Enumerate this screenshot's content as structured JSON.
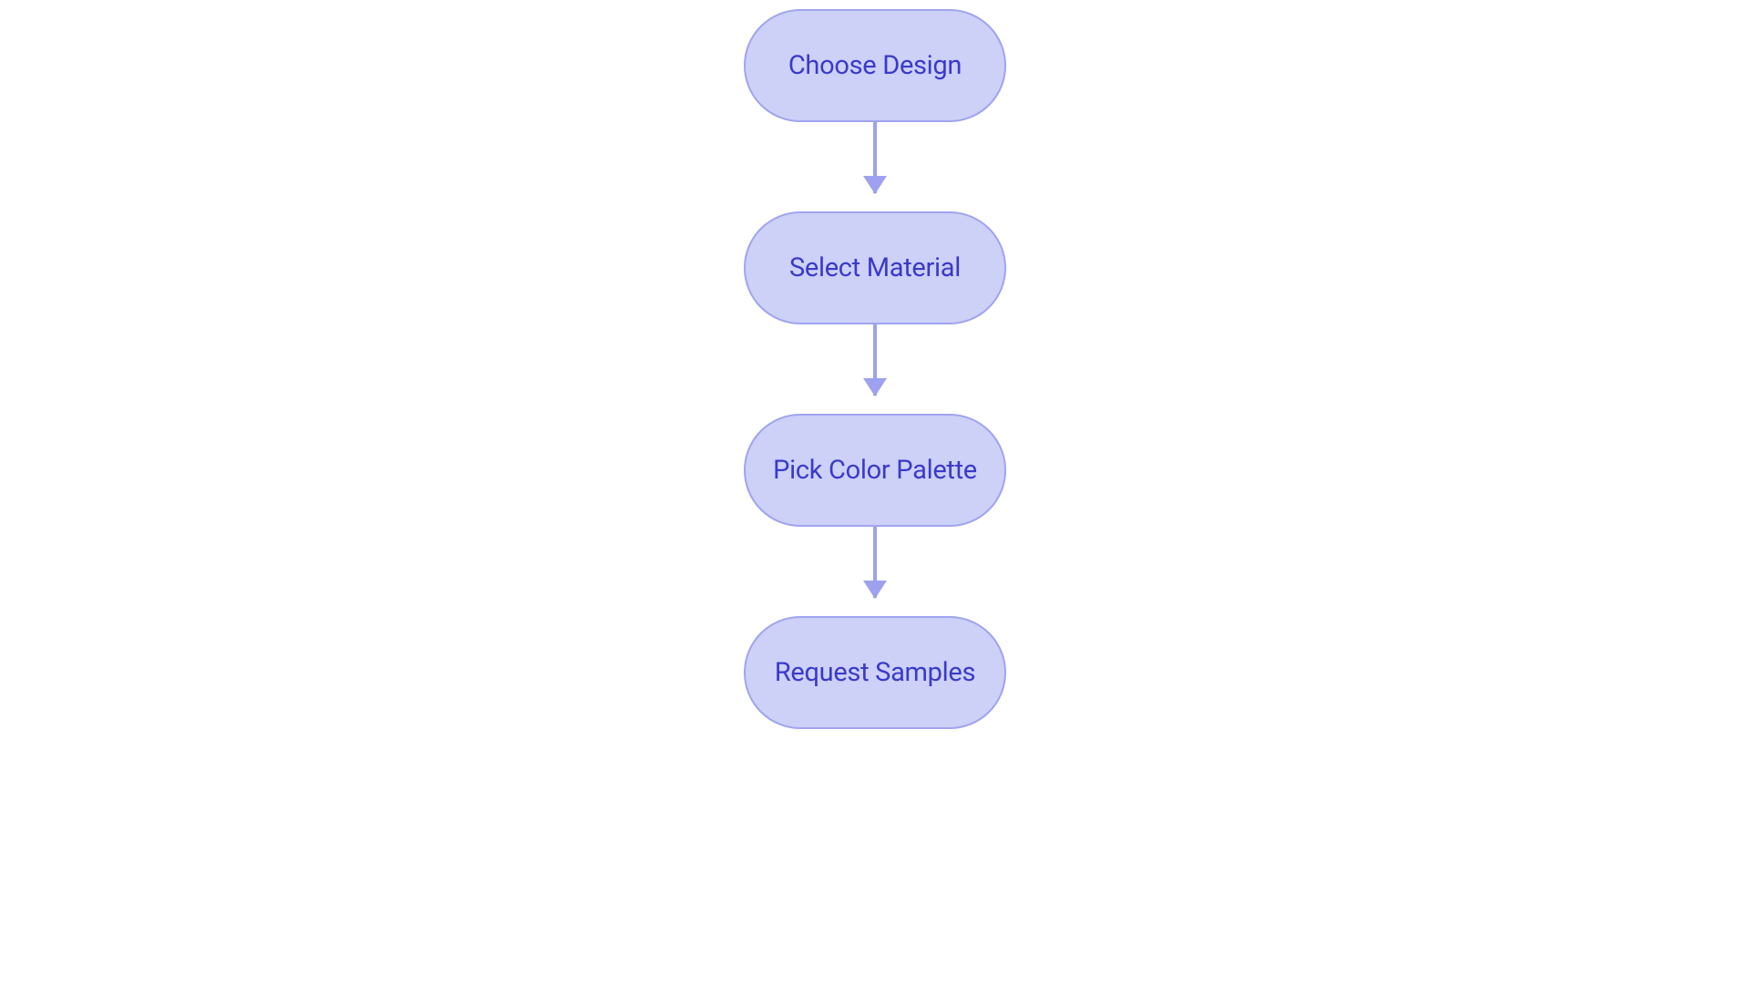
{
  "flowchart": {
    "nodes": [
      {
        "label": "Choose Design"
      },
      {
        "label": "Select Material"
      },
      {
        "label": "Pick Color Palette"
      },
      {
        "label": "Request Samples"
      }
    ],
    "colors": {
      "nodeFill": "#cdd0f7",
      "nodeBorder": "#a0a4f0",
      "nodeText": "#3a3ac9",
      "arrow": "#9da1ef"
    }
  }
}
